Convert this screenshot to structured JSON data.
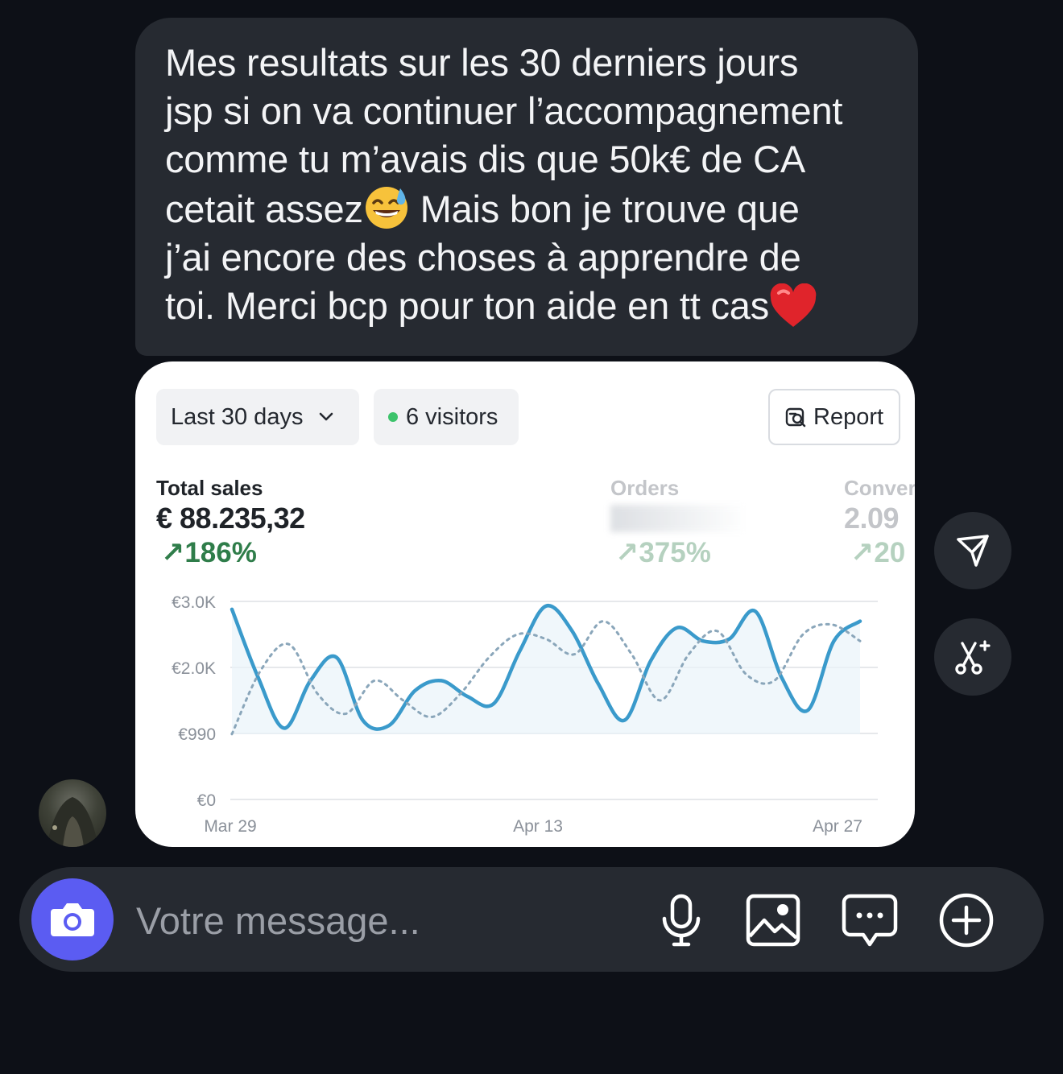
{
  "message": {
    "text_part1": "Mes resultats sur les 30 derniers jours\njsp si on va continuer l’accompagnement\ncomme tu m’avais dis que 50k€ de CA\ncetait assez",
    "text_part2": " Mais bon je trouve que\nj’ai encore des choses à apprendre de\ntoi. Merci bcp pour ton aide en tt cas",
    "emoji_1": "grinning-face-with-sweat-emoji",
    "emoji_2": "red-heart-emoji"
  },
  "dashboard": {
    "date_range": "Last 30 days",
    "visitors": "6 visitors",
    "report_label": "Report",
    "kpis": {
      "total_sales": {
        "label": "Total sales",
        "value": "€ 88.235,32",
        "change": "↗186%"
      },
      "orders": {
        "label": "Orders",
        "value": "",
        "change": "↗375%"
      },
      "conversion": {
        "label": "Conver",
        "value": "2.09",
        "change": "↗20"
      }
    }
  },
  "chart_data": {
    "type": "line",
    "y_tick_labels": [
      "€3.0K",
      "€2.0K",
      "€990",
      "€0"
    ],
    "x_tick_labels": [
      "Mar 29",
      "Apr 13",
      "Apr 27"
    ],
    "ylim": [
      0,
      3000
    ],
    "series": [
      {
        "style": "solid",
        "color": "#3a9acb",
        "values": [
          2880,
          1850,
          1080,
          1800,
          2150,
          1200,
          1120,
          1650,
          1800,
          1560,
          1450,
          2250,
          2930,
          2550,
          1750,
          1200,
          2100,
          2600,
          2400,
          2430,
          2850,
          1850,
          1350,
          2400,
          2700
        ]
      },
      {
        "style": "dotted",
        "color": "#8aa6ba",
        "values": [
          990,
          1950,
          2350,
          1600,
          1300,
          1800,
          1500,
          1250,
          1600,
          2150,
          2500,
          2430,
          2200,
          2700,
          2200,
          1500,
          2200,
          2550,
          1900,
          1800,
          2500,
          2650,
          2400
        ]
      }
    ]
  },
  "composer": {
    "placeholder": "Votre message..."
  },
  "icons": {
    "side_1": "send-icon",
    "side_2": "scissors-sparkle-icon",
    "camera": "camera-icon",
    "mic": "microphone-icon",
    "gallery": "image-icon",
    "sticker": "chat-bubble-icon",
    "plus": "plus-circle-icon"
  },
  "colors": {
    "background": "#0d1017",
    "bubble": "#262a31",
    "accent": "#5b5cf2",
    "positive": "#2f7d4a"
  }
}
